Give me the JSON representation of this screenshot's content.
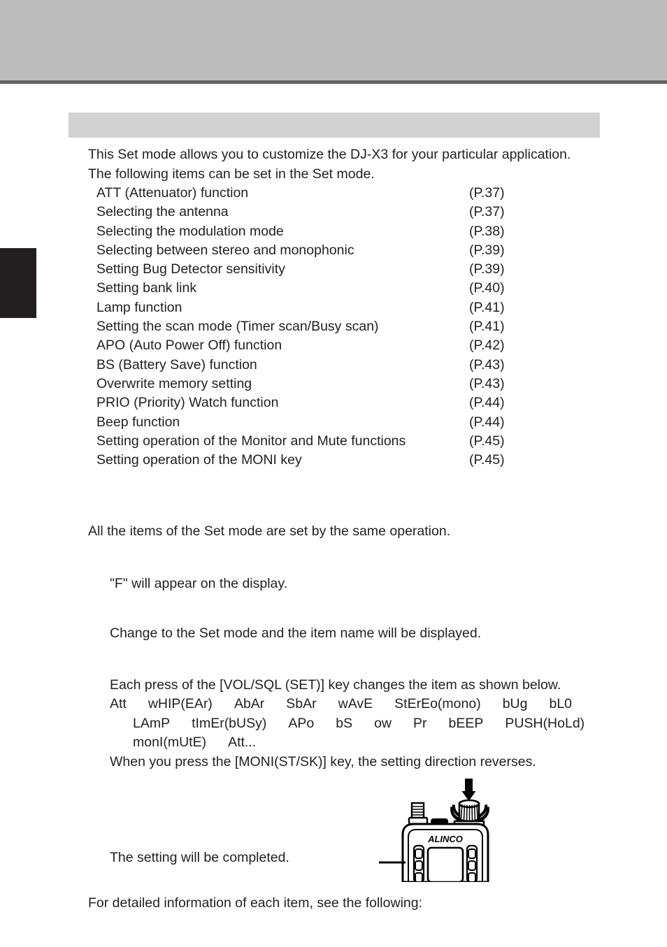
{
  "page": {
    "section_title": "",
    "intro": {
      "line1": "This Set mode allows you to customize the DJ-X3 for your particular application.",
      "line2": "The following items can be set in the Set mode."
    },
    "items": [
      {
        "label": "ATT (Attenuator) function",
        "page": "(P.37)"
      },
      {
        "label": "Selecting the antenna",
        "page": "(P.37)"
      },
      {
        "label": "Selecting the modulation mode",
        "page": "(P.38)"
      },
      {
        "label": "Selecting between stereo and monophonic",
        "page": "(P.39)"
      },
      {
        "label": "Setting Bug Detector sensitivity",
        "page": "(P.39)"
      },
      {
        "label": "Setting bank link",
        "page": "(P.40)"
      },
      {
        "label": "Lamp function",
        "page": "(P.41)"
      },
      {
        "label": "Setting the scan mode (Timer scan/Busy scan)",
        "page": "(P.41)"
      },
      {
        "label": "APO (Auto Power Off) function",
        "page": "(P.42)"
      },
      {
        "label": "BS (Battery Save) function",
        "page": "(P.43)"
      },
      {
        "label": "Overwrite memory setting",
        "page": "(P.43)"
      },
      {
        "label": "PRIO (Priority) Watch function",
        "page": "(P.44)"
      },
      {
        "label": "Beep function",
        "page": "(P.44)"
      },
      {
        "label": "Setting operation of the Monitor and Mute functions",
        "page": "(P.45)"
      },
      {
        "label": "Setting operation of the MONI key",
        "page": "(P.45)"
      }
    ],
    "all_items_note": "All the items of the Set mode are set by the same operation.",
    "steps": {
      "step1": "\"F\" will appear on the display.",
      "step2": "Change to the Set mode and the item name will be displayed.",
      "step3_intro": "Each press of the [VOL/SQL (SET)] key changes the item as shown below.",
      "sequence_line1": [
        "Att",
        "wHIP(EAr)",
        "AbAr",
        "SbAr",
        "wAvE",
        "StErEo(mono)",
        "bUg",
        "bL0"
      ],
      "sequence_line2": [
        "LAmP",
        "tImEr(bUSy)",
        "APo",
        "bS",
        "ow",
        "Pr",
        "bEEP",
        "PUSH(HoLd)"
      ],
      "sequence_line3": [
        "monI(mUtE)",
        "Att..."
      ],
      "step3_note": "When you press the [MONI(ST/SK)] key, the setting direction reverses.",
      "step4": "The setting will be completed."
    },
    "closing": "For detailed information of each item, see the following:",
    "figure": {
      "brand": "ALINCO",
      "name": "dj-x3-top-view-with-dial"
    },
    "colors": {
      "top_band": "#bcbcbc",
      "top_rule": "#636363",
      "section_header": "#d2d2d2",
      "side_tab": "#231f20",
      "text": "#231f20"
    }
  }
}
